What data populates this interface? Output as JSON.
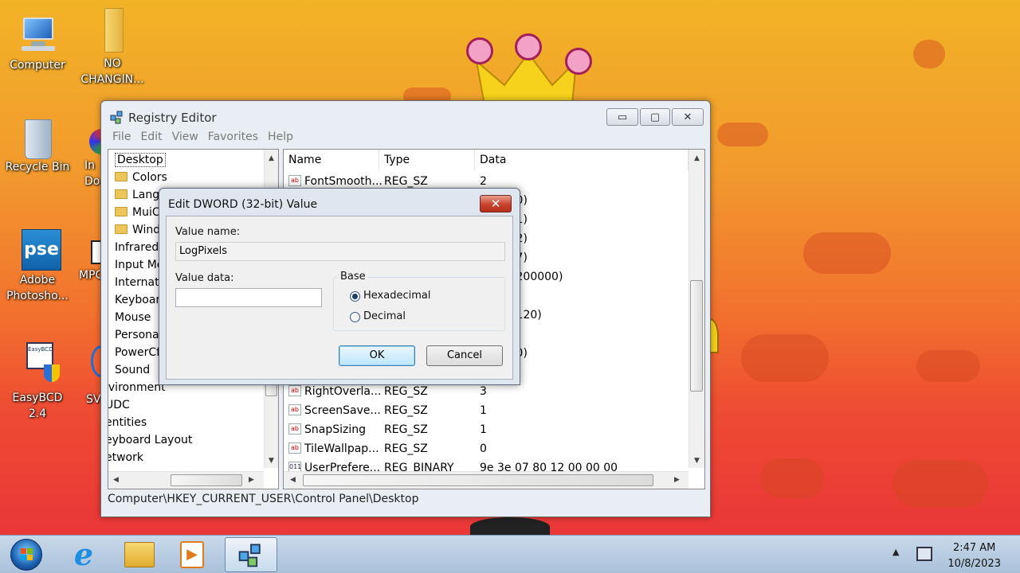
{
  "desktop": {
    "icons": [
      {
        "label": "Computer",
        "icon": "computer-icon"
      },
      {
        "label": "NO CHANGIN...",
        "icon": "folder-icon"
      },
      {
        "label": "Recycle Bin",
        "icon": "recycle-bin-icon"
      },
      {
        "label": "In Do",
        "icon": "app-icon"
      },
      {
        "label": "Adobe Photosho...",
        "icon": "photoshop-elements-icon",
        "badge": "pse"
      },
      {
        "label": "MPC",
        "icon": "mpc-icon"
      },
      {
        "label": "EasyBCD 2.4",
        "icon": "easybcd-icon",
        "badge": "EasyBCD"
      },
      {
        "label": "SV",
        "icon": "app-icon"
      }
    ]
  },
  "registry_editor": {
    "title": "Registry Editor",
    "controls": {
      "minimize": "▭",
      "maximize": "▢",
      "close": "✕"
    },
    "menu": [
      "File",
      "Edit",
      "View",
      "Favorites",
      "Help"
    ],
    "tree": [
      {
        "label": "Desktop",
        "folder": false,
        "indent": 1,
        "selected": true
      },
      {
        "label": "Colors",
        "folder": true,
        "indent": 2
      },
      {
        "label": "Lang",
        "folder": true,
        "indent": 2
      },
      {
        "label": "MuiC",
        "folder": true,
        "indent": 2
      },
      {
        "label": "Wind",
        "folder": true,
        "indent": 2
      },
      {
        "label": "Infrared",
        "folder": false,
        "indent": 1
      },
      {
        "label": "Input Me",
        "folder": false,
        "indent": 1
      },
      {
        "label": "Internati",
        "folder": false,
        "indent": 1
      },
      {
        "label": "Keyboar",
        "folder": false,
        "indent": 1
      },
      {
        "label": "Mouse",
        "folder": false,
        "indent": 1
      },
      {
        "label": "Persona",
        "folder": false,
        "indent": 1
      },
      {
        "label": "PowerCf",
        "folder": false,
        "indent": 1
      },
      {
        "label": "Sound",
        "folder": false,
        "indent": 1
      },
      {
        "label": "ivironment",
        "folder": false,
        "indent": 0
      },
      {
        "label": "UDC",
        "folder": false,
        "indent": 0
      },
      {
        "label": "entities",
        "folder": false,
        "indent": 0
      },
      {
        "label": "eyboard Layout",
        "folder": false,
        "indent": 0
      },
      {
        "label": "etwork",
        "folder": false,
        "indent": 0
      }
    ],
    "columns": {
      "name": "Name",
      "type": "Type",
      "data": "Data"
    },
    "values": [
      {
        "name": "FontSmooth...",
        "type": "REG_SZ",
        "data": "2",
        "icon": "ab"
      },
      {
        "name": "",
        "type": "",
        "data": "0000 (0)",
        "icon": ""
      },
      {
        "name": "",
        "type": "",
        "data": "0001 (1)",
        "icon": ""
      },
      {
        "name": "",
        "type": "",
        "data": "0002 (2)",
        "icon": ""
      },
      {
        "name": "",
        "type": "",
        "data": "0007 (7)",
        "icon": ""
      },
      {
        "name": "",
        "type": "",
        "data": "0d40 (200000)",
        "icon": ""
      },
      {
        "name": "",
        "type": "",
        "data": "",
        "icon": ""
      },
      {
        "name": "",
        "type": "",
        "data": "0078 (120)",
        "icon": ""
      },
      {
        "name": "",
        "type": "",
        "data": "",
        "icon": ""
      },
      {
        "name": "",
        "type": "",
        "data": "0000 (0)",
        "icon": ""
      },
      {
        "name": "",
        "type": "",
        "data": "",
        "icon": ""
      },
      {
        "name": "RightOverla...",
        "type": "REG_SZ",
        "data": "3",
        "icon": "ab"
      },
      {
        "name": "ScreenSave...",
        "type": "REG_SZ",
        "data": "1",
        "icon": "ab"
      },
      {
        "name": "SnapSizing",
        "type": "REG_SZ",
        "data": "1",
        "icon": "ab"
      },
      {
        "name": "TileWallpap...",
        "type": "REG_SZ",
        "data": "0",
        "icon": "ab"
      },
      {
        "name": "UserPrefere...",
        "type": "REG_BINARY",
        "data": "9e 3e 07 80 12 00 00 00",
        "icon": "bin"
      }
    ],
    "status": "Computer\\HKEY_CURRENT_USER\\Control Panel\\Desktop"
  },
  "dialog": {
    "title": "Edit DWORD (32-bit) Value",
    "close": "✕",
    "value_name_label": "Value name:",
    "value_name": "LogPixels",
    "value_data_label": "Value data:",
    "value_data": "",
    "base_label": "Base",
    "radio_hex": "Hexadecimal",
    "radio_dec": "Decimal",
    "selected_base": "Hexadecimal",
    "ok": "OK",
    "cancel": "Cancel"
  },
  "taskbar": {
    "items": [
      "start-orb-icon",
      "internet-explorer-icon",
      "windows-explorer-icon",
      "media-player-icon",
      "registry-editor-icon"
    ],
    "time": "2:47 AM",
    "date": "10/8/2023",
    "tray": [
      "show-hidden-icons-icon",
      "network-icon"
    ]
  }
}
